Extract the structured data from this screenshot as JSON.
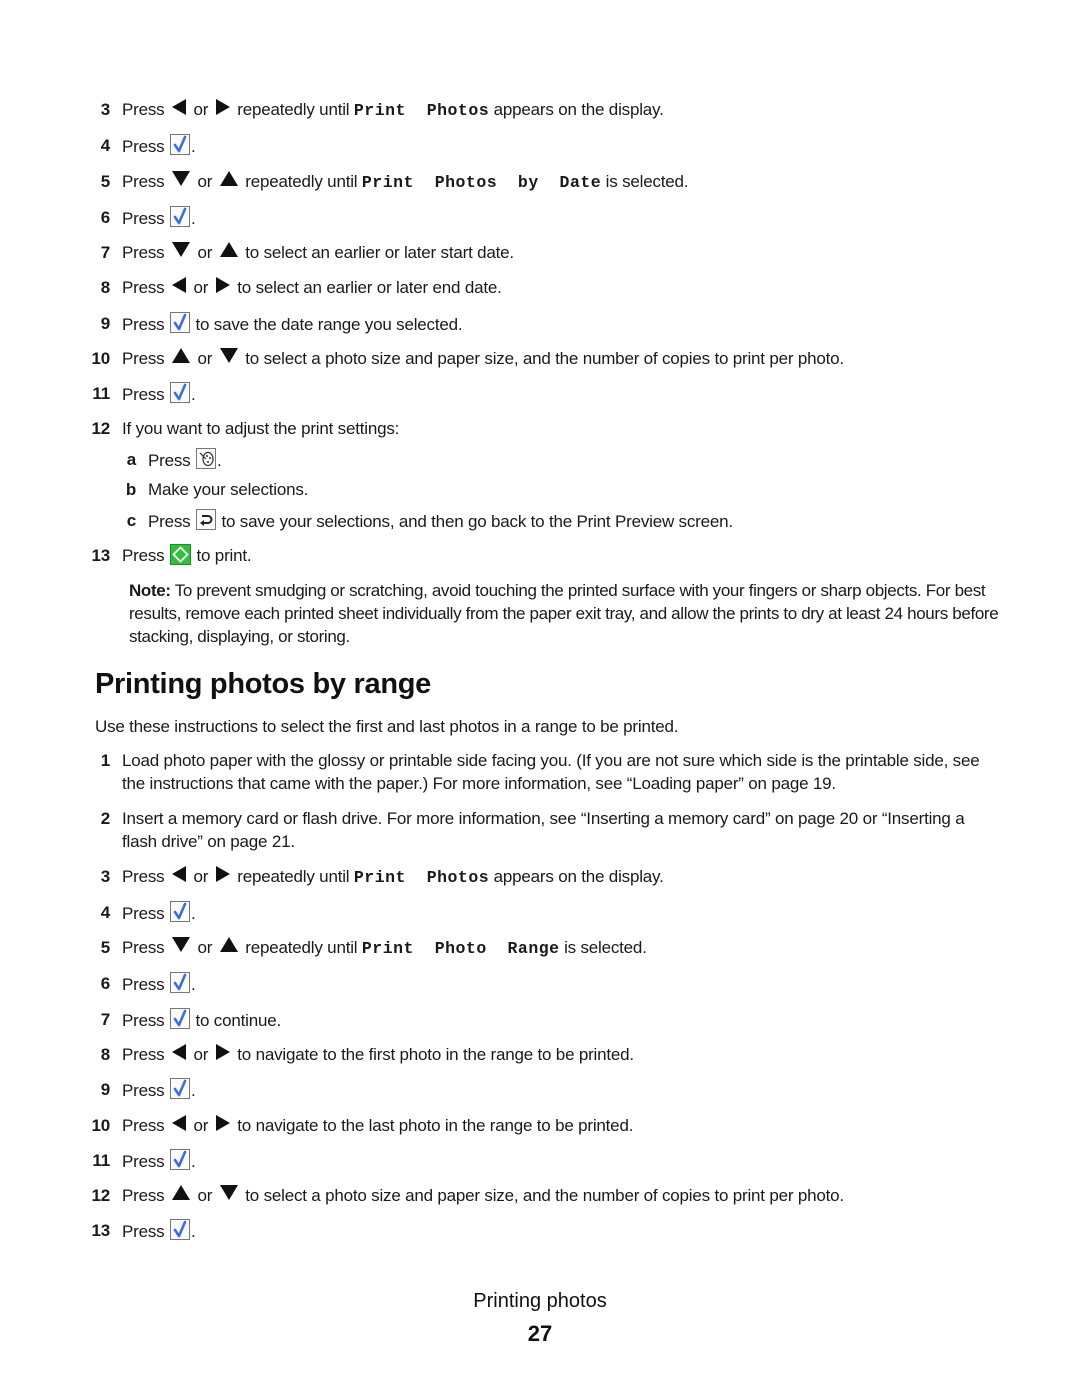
{
  "colors": {
    "text": "#1a1a1a",
    "check_blue": "#3a6fe0",
    "go_green": "#2fbf3a"
  },
  "section1": {
    "steps": [
      {
        "num": "3",
        "segments": [
          {
            "t": "text",
            "v": "Press "
          },
          {
            "t": "icon",
            "v": "left-arrow"
          },
          {
            "t": "text",
            "v": " or "
          },
          {
            "t": "icon",
            "v": "right-arrow"
          },
          {
            "t": "text",
            "v": " repeatedly until "
          },
          {
            "t": "code",
            "v": "Print  Photos"
          },
          {
            "t": "text",
            "v": " appears on the display."
          }
        ]
      },
      {
        "num": "4",
        "segments": [
          {
            "t": "text",
            "v": "Press "
          },
          {
            "t": "icon",
            "v": "check"
          },
          {
            "t": "text",
            "v": "."
          }
        ]
      },
      {
        "num": "5",
        "segments": [
          {
            "t": "text",
            "v": "Press "
          },
          {
            "t": "icon",
            "v": "down-arrow"
          },
          {
            "t": "text",
            "v": " or "
          },
          {
            "t": "icon",
            "v": "up-arrow"
          },
          {
            "t": "text",
            "v": " repeatedly until "
          },
          {
            "t": "code",
            "v": "Print  Photos  by  Date"
          },
          {
            "t": "text",
            "v": " is selected."
          }
        ]
      },
      {
        "num": "6",
        "segments": [
          {
            "t": "text",
            "v": "Press "
          },
          {
            "t": "icon",
            "v": "check"
          },
          {
            "t": "text",
            "v": "."
          }
        ]
      },
      {
        "num": "7",
        "segments": [
          {
            "t": "text",
            "v": "Press "
          },
          {
            "t": "icon",
            "v": "down-arrow"
          },
          {
            "t": "text",
            "v": " or "
          },
          {
            "t": "icon",
            "v": "up-arrow"
          },
          {
            "t": "text",
            "v": " to select an earlier or later start date."
          }
        ]
      },
      {
        "num": "8",
        "segments": [
          {
            "t": "text",
            "v": "Press "
          },
          {
            "t": "icon",
            "v": "left-arrow"
          },
          {
            "t": "text",
            "v": " or "
          },
          {
            "t": "icon",
            "v": "right-arrow"
          },
          {
            "t": "text",
            "v": " to select an earlier or later end date."
          }
        ]
      },
      {
        "num": "9",
        "segments": [
          {
            "t": "text",
            "v": "Press "
          },
          {
            "t": "icon",
            "v": "check"
          },
          {
            "t": "text",
            "v": " to save the date range you selected."
          }
        ]
      },
      {
        "num": "10",
        "segments": [
          {
            "t": "text",
            "v": "Press "
          },
          {
            "t": "icon",
            "v": "up-arrow"
          },
          {
            "t": "text",
            "v": " or "
          },
          {
            "t": "icon",
            "v": "down-arrow"
          },
          {
            "t": "text",
            "v": " to select a photo size and paper size, and the number of copies to print per photo."
          }
        ]
      },
      {
        "num": "11",
        "segments": [
          {
            "t": "text",
            "v": "Press "
          },
          {
            "t": "icon",
            "v": "check"
          },
          {
            "t": "text",
            "v": "."
          }
        ]
      },
      {
        "num": "12",
        "segments": [
          {
            "t": "text",
            "v": "If you want to adjust the print settings:"
          }
        ]
      },
      {
        "num": "a",
        "sub": true,
        "segments": [
          {
            "t": "text",
            "v": "Press "
          },
          {
            "t": "icon",
            "v": "palette"
          },
          {
            "t": "text",
            "v": "."
          }
        ]
      },
      {
        "num": "b",
        "sub": true,
        "segments": [
          {
            "t": "text",
            "v": "Make your selections."
          }
        ]
      },
      {
        "num": "c",
        "sub": true,
        "segments": [
          {
            "t": "text",
            "v": "Press "
          },
          {
            "t": "icon",
            "v": "back"
          },
          {
            "t": "text",
            "v": " to save your selections, and then go back to the Print Preview screen."
          }
        ]
      },
      {
        "num": "13",
        "segments": [
          {
            "t": "text",
            "v": "Press "
          },
          {
            "t": "icon",
            "v": "start"
          },
          {
            "t": "text",
            "v": " to print."
          }
        ]
      }
    ]
  },
  "note": {
    "label": "Note:",
    "text": " To prevent smudging or scratching, avoid touching the printed surface with your fingers or sharp objects. For best results, remove each printed sheet individually from the paper exit tray, and allow the prints to dry at least 24 hours before stacking, displaying, or storing."
  },
  "section2": {
    "heading": "Printing photos by range",
    "intro": "Use these instructions to select the first and last photos in a range to be printed.",
    "steps": [
      {
        "num": "1",
        "segments": [
          {
            "t": "text",
            "v": "Load photo paper with the glossy or printable side facing you. (If you are not sure which side is the printable side, see the instructions that came with the paper.) For more information, see “Loading paper” on page 19."
          }
        ]
      },
      {
        "num": "2",
        "segments": [
          {
            "t": "text",
            "v": "Insert a memory card or flash drive. For more information, see “Inserting a memory card” on page 20 or “Inserting a flash drive” on page 21."
          }
        ]
      },
      {
        "num": "3",
        "segments": [
          {
            "t": "text",
            "v": "Press "
          },
          {
            "t": "icon",
            "v": "left-arrow"
          },
          {
            "t": "text",
            "v": " or "
          },
          {
            "t": "icon",
            "v": "right-arrow"
          },
          {
            "t": "text",
            "v": " repeatedly until "
          },
          {
            "t": "code",
            "v": "Print  Photos"
          },
          {
            "t": "text",
            "v": " appears on the display."
          }
        ]
      },
      {
        "num": "4",
        "segments": [
          {
            "t": "text",
            "v": "Press "
          },
          {
            "t": "icon",
            "v": "check"
          },
          {
            "t": "text",
            "v": "."
          }
        ]
      },
      {
        "num": "5",
        "segments": [
          {
            "t": "text",
            "v": "Press "
          },
          {
            "t": "icon",
            "v": "down-arrow"
          },
          {
            "t": "text",
            "v": " or "
          },
          {
            "t": "icon",
            "v": "up-arrow"
          },
          {
            "t": "text",
            "v": " repeatedly until "
          },
          {
            "t": "code",
            "v": "Print  Photo  Range"
          },
          {
            "t": "text",
            "v": " is selected."
          }
        ]
      },
      {
        "num": "6",
        "segments": [
          {
            "t": "text",
            "v": "Press "
          },
          {
            "t": "icon",
            "v": "check"
          },
          {
            "t": "text",
            "v": "."
          }
        ]
      },
      {
        "num": "7",
        "segments": [
          {
            "t": "text",
            "v": "Press "
          },
          {
            "t": "icon",
            "v": "check"
          },
          {
            "t": "text",
            "v": " to continue."
          }
        ]
      },
      {
        "num": "8",
        "segments": [
          {
            "t": "text",
            "v": "Press "
          },
          {
            "t": "icon",
            "v": "left-arrow"
          },
          {
            "t": "text",
            "v": " or "
          },
          {
            "t": "icon",
            "v": "right-arrow"
          },
          {
            "t": "text",
            "v": " to navigate to the first photo in the range to be printed."
          }
        ]
      },
      {
        "num": "9",
        "segments": [
          {
            "t": "text",
            "v": "Press "
          },
          {
            "t": "icon",
            "v": "check"
          },
          {
            "t": "text",
            "v": "."
          }
        ]
      },
      {
        "num": "10",
        "segments": [
          {
            "t": "text",
            "v": "Press "
          },
          {
            "t": "icon",
            "v": "left-arrow"
          },
          {
            "t": "text",
            "v": " or "
          },
          {
            "t": "icon",
            "v": "right-arrow"
          },
          {
            "t": "text",
            "v": " to navigate to the last photo in the range to be printed."
          }
        ]
      },
      {
        "num": "11",
        "segments": [
          {
            "t": "text",
            "v": "Press "
          },
          {
            "t": "icon",
            "v": "check"
          },
          {
            "t": "text",
            "v": "."
          }
        ]
      },
      {
        "num": "12",
        "segments": [
          {
            "t": "text",
            "v": "Press "
          },
          {
            "t": "icon",
            "v": "up-arrow"
          },
          {
            "t": "text",
            "v": " or "
          },
          {
            "t": "icon",
            "v": "down-arrow"
          },
          {
            "t": "text",
            "v": " to select a photo size and paper size, and the number of copies to print per photo."
          }
        ]
      },
      {
        "num": "13",
        "segments": [
          {
            "t": "text",
            "v": "Press "
          },
          {
            "t": "icon",
            "v": "check"
          },
          {
            "t": "text",
            "v": "."
          }
        ]
      }
    ]
  },
  "footer": {
    "section_title": "Printing photos",
    "page_number": "27"
  }
}
